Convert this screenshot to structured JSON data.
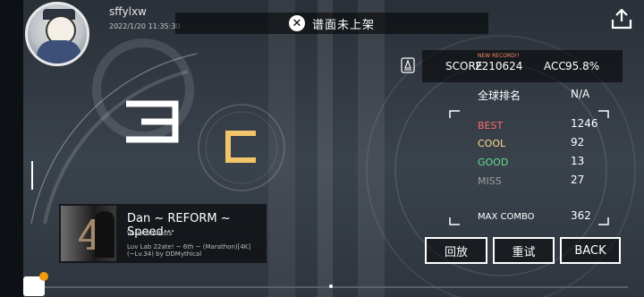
{
  "user": {
    "name": "sffylxw",
    "datetime": "2022/1/20 11:35:30"
  },
  "banner": {
    "text": "谱面未上架",
    "icon": "close-circle-icon"
  },
  "score": {
    "new_record": "NEW RECORD!!",
    "score_label": "SCORE",
    "score_value": "2210624",
    "acc_label": "ACC.",
    "acc_value": "95.8%"
  },
  "global_rank": {
    "label": "全球排名",
    "value": "N/A"
  },
  "judgements": [
    {
      "label": "BEST",
      "value": "1246",
      "color": "#ff6b6b"
    },
    {
      "label": "COOL",
      "value": "92",
      "color": "#ffe08a"
    },
    {
      "label": "GOOD",
      "value": "13",
      "color": "#5fe08e"
    },
    {
      "label": "MISS",
      "value": "27",
      "color": "#a0a0a0"
    }
  ],
  "max_combo": {
    "label": "MAX COMBO",
    "value": "362"
  },
  "grade": {
    "left": "3",
    "right": "C",
    "left_color": "#ffffff",
    "right_color": "#f2c56b"
  },
  "song": {
    "title": "Dan ~ REFORM ~ Speed···",
    "artist": "Various Artists",
    "chart": "Luv Lab 22ate! ~ 6th ~ (Marathon)[4K](~Lv.34) by DDMythical",
    "jacket_number": "4"
  },
  "buttons": {
    "replay": "回放",
    "retry": "重试",
    "back": "BACK"
  },
  "icons": {
    "share": "share-upload-icon",
    "rank": "rank-badge-icon"
  }
}
